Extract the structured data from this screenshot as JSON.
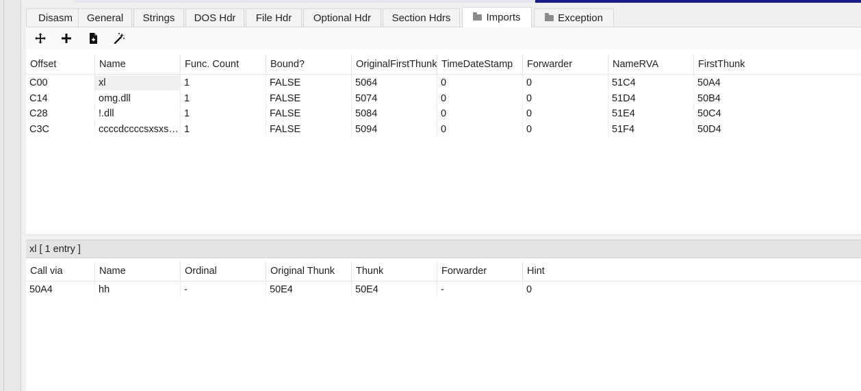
{
  "tabs": [
    {
      "label": "Disasm",
      "icon": null
    },
    {
      "label": "General",
      "icon": null
    },
    {
      "label": "Strings",
      "icon": null
    },
    {
      "label": "DOS Hdr",
      "icon": null
    },
    {
      "label": "File Hdr",
      "icon": null
    },
    {
      "label": "Optional Hdr",
      "icon": null
    },
    {
      "label": "Section Hdrs",
      "icon": null
    },
    {
      "label": "Imports",
      "icon": "folder-icon",
      "active": true
    },
    {
      "label": "Exception",
      "icon": "folder-icon"
    }
  ],
  "toolbar": {
    "buttons": [
      "move-icon",
      "add-icon",
      "save-file-icon",
      "magic-wand-icon"
    ]
  },
  "imports_table": {
    "columns": [
      "Offset",
      "Name",
      "Func. Count",
      "Bound?",
      "OriginalFirstThunk",
      "TimeDateStamp",
      "Forwarder",
      "NameRVA",
      "FirstThunk"
    ],
    "rows": [
      [
        "C00",
        "xl",
        "1",
        "FALSE",
        "5064",
        "0",
        "0",
        "51C4",
        "50A4"
      ],
      [
        "C14",
        "omg.dll",
        "1",
        "FALSE",
        "5074",
        "0",
        "0",
        "51D4",
        "50B4"
      ],
      [
        "C28",
        "!.dll",
        "1",
        "FALSE",
        "5084",
        "0",
        "0",
        "51E4",
        "50C4"
      ],
      [
        "C3C",
        "ccccdccccsxsxsx...",
        "1",
        "FALSE",
        "5094",
        "0",
        "0",
        "51F4",
        "50D4"
      ]
    ]
  },
  "detail": {
    "header": "xl   [ 1 entry ]",
    "columns": [
      "Call via",
      "Name",
      "Ordinal",
      "Original Thunk",
      "Thunk",
      "Forwarder",
      "Hint"
    ],
    "rows": [
      [
        "50A4",
        "hh",
        "-",
        "50E4",
        "50E4",
        "-",
        "0"
      ]
    ]
  },
  "colors": {
    "accent_strip": "#1a1a8c",
    "tab_bg": "#f3f3f3",
    "table_bg": "#ffffff"
  }
}
